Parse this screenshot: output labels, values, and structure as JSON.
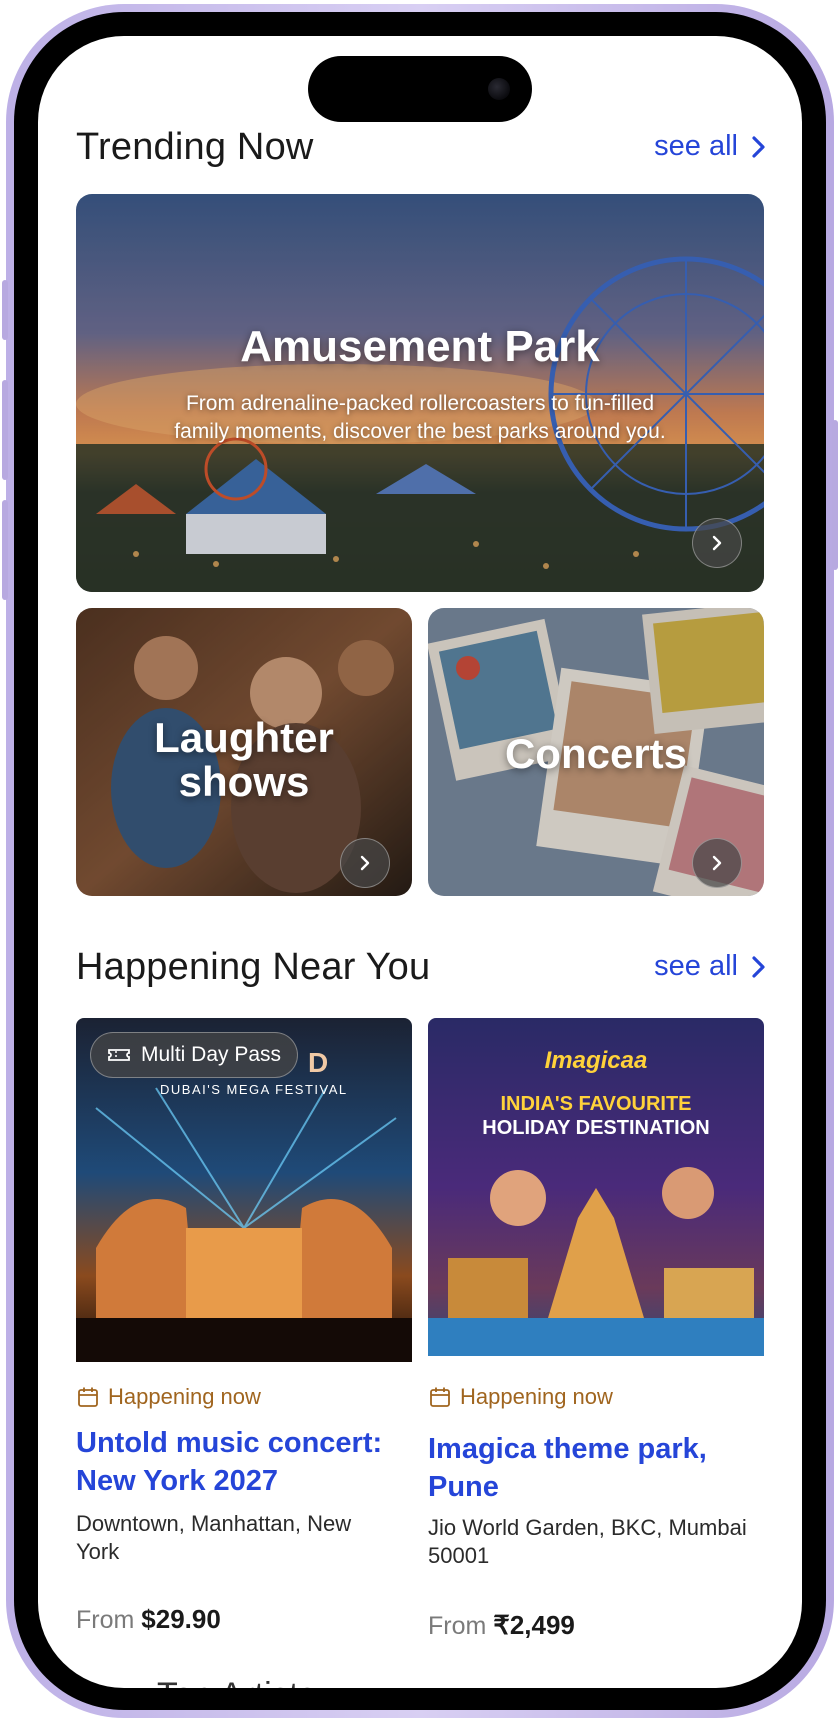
{
  "trending": {
    "title": "Trending Now",
    "see_all": "see all",
    "hero": {
      "title": "Amusement Park",
      "subtitle_line1": "From adrenaline-packed rollercoasters to fun-filled",
      "subtitle_line2": "family moments, discover the best parks around you."
    },
    "cards": [
      {
        "line1": "Laughter",
        "line2": "shows"
      },
      {
        "line1": "Concerts"
      }
    ]
  },
  "nearby": {
    "title": "Happening Near You",
    "see_all": "see all",
    "events": [
      {
        "chip": "Multi Day Pass",
        "poster_text": "DUBAI'S MEGA FESTIVAL",
        "poster_letter": "D",
        "status": "Happening now",
        "title_line1": "Untold music concert:",
        "title_line2": "New York 2027",
        "location_line1": "Downtown, Manhattan, New",
        "location_line2": "York",
        "price_prefix": "From",
        "price": "$29.90"
      },
      {
        "poster_brand": "Imagicaa",
        "poster_line1": "INDIA'S FAVOURITE",
        "poster_line2": "HOLIDAY DESTINATION",
        "status": "Happening now",
        "title_line1": "Imagica theme park,",
        "title_line2": "Pune",
        "location_line1": "Jio World Garden, BKC, Mumbai",
        "location_line2": "50001",
        "price_prefix": "From",
        "price": "₹2,499"
      }
    ]
  },
  "next_section_peek": "...Top Artists",
  "colors": {
    "link": "#2545d8",
    "status": "#a0651f",
    "frame": "#c4b8ea"
  }
}
